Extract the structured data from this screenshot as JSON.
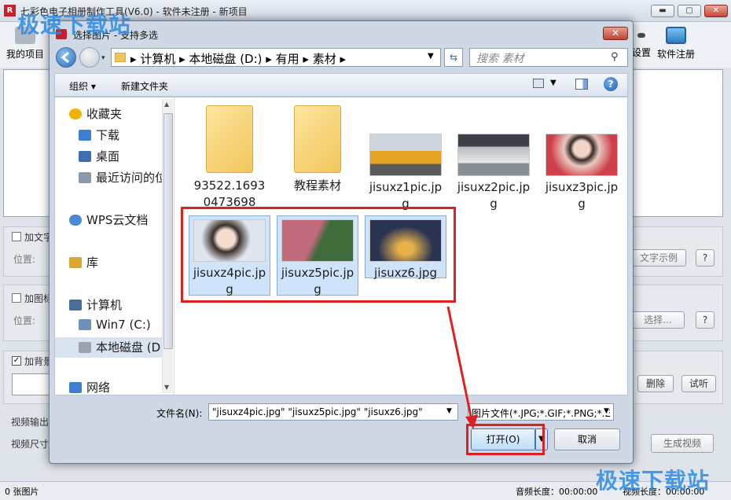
{
  "app": {
    "title": "七彩色电子相册制作工具(V6.0) - 软件未注册 - 新项目",
    "logo_text": "R",
    "min": "▬",
    "max": "▢",
    "close": "✕"
  },
  "toolbar": {
    "items": [
      {
        "label": "我的项目",
        "icon": "folder-icon"
      },
      {
        "label": "设置",
        "icon": "settings-icon"
      },
      {
        "label": "软件注册",
        "icon": "monitor-icon"
      }
    ]
  },
  "main": {
    "add_text": "加文字",
    "position_1": "位置:",
    "text_sample": "文字示例",
    "help": "?",
    "add_image": "加图标",
    "position_2": "位置:",
    "choose": "选择...",
    "add_bg": "加背景",
    "delete": "删除",
    "listen": "试听",
    "video_output": "视频输出",
    "video_size": "视频尺寸",
    "generate": "生成视频"
  },
  "status": {
    "count": "0 张图片",
    "audio": "音频长度：00:00:00",
    "video": "视频长度：00:00:00"
  },
  "watermark": "极速下载站",
  "dialog": {
    "title": "选择图片 - 支持多选",
    "close": "✕",
    "breadcrumb": [
      "计算机",
      "本地磁盘 (D:)",
      "有用",
      "素材"
    ],
    "search_placeholder": "搜索 素材",
    "organize": "组织 ▾",
    "new_folder": "新建文件夹",
    "nav": [
      {
        "label": "收藏夹",
        "icon": "star-icon",
        "color": "#f0b400"
      },
      {
        "label": "下载",
        "icon": "download-icon",
        "color": "#3c7fd0"
      },
      {
        "label": "桌面",
        "icon": "desktop-icon",
        "color": "#3c6fb0"
      },
      {
        "label": "最近访问的位置",
        "icon": "recent-icon",
        "color": "#8899aa"
      },
      {
        "label": "WPS云文档",
        "icon": "cloud-icon",
        "color": "#4a8ad8"
      },
      {
        "label": "库",
        "icon": "library-icon",
        "color": "#d9a63a"
      },
      {
        "label": "计算机",
        "icon": "computer-icon",
        "color": "#4a6d9a"
      },
      {
        "label": "Win7 (C:)",
        "icon": "drive-icon",
        "color": "#6d8fb8"
      },
      {
        "label": "本地磁盘 (D:)",
        "icon": "drive-icon",
        "color": "#9aa4b0"
      },
      {
        "label": "网络",
        "icon": "network-icon",
        "color": "#3c7fd0"
      }
    ],
    "files_row1": [
      {
        "name_l1": "93522.1693",
        "name_l2": "0473698",
        "type": "folder"
      },
      {
        "name_l1": "教程素材",
        "name_l2": "",
        "type": "folder"
      },
      {
        "name_l1": "jisuxz1pic.jp",
        "name_l2": "g",
        "type": "image",
        "color": "#e7a422"
      },
      {
        "name_l1": "jisuxz2pic.jp",
        "name_l2": "g",
        "type": "image",
        "color": "#8a8f96"
      },
      {
        "name_l1": "jisuxz3pic.jp",
        "name_l2": "g",
        "type": "image",
        "color": "#e9c9c1"
      }
    ],
    "files_row2": [
      {
        "name_l1": "jisuxz4pic.jp",
        "name_l2": "g",
        "color": "#d9cfc8"
      },
      {
        "name_l1": "jisuxz5pic.jp",
        "name_l2": "g",
        "color": "#b25a6a"
      },
      {
        "name_l1": "jisuxz6.jpg",
        "name_l2": "",
        "color": "#2b3552"
      }
    ],
    "filename_label": "文件名(N):",
    "filename_value": "\"jisuxz4pic.jpg\" \"jisuxz5pic.jpg\" \"jisuxz6.jpg\"",
    "filetype_value": "图片文件(*.JPG;*.GIF;*.PNG;*.E",
    "open": "打开(O)",
    "cancel": "取消"
  }
}
